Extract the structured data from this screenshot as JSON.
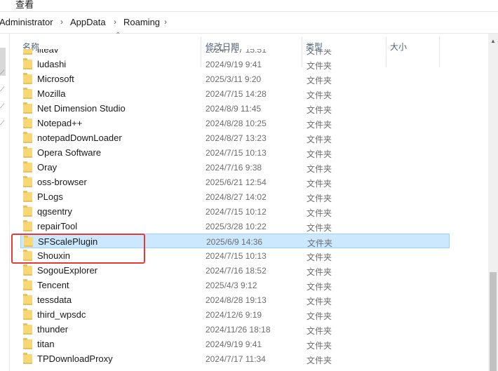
{
  "menu": {
    "view_label": "查看"
  },
  "breadcrumb": [
    "Administrator",
    "AppData",
    "Roaming"
  ],
  "columns": {
    "name": "名称",
    "date": "修改日期",
    "type": "类型",
    "size": "大小"
  },
  "files": [
    {
      "name": "liteav",
      "date": "2024/7/17 15:51",
      "type": "文件夹"
    },
    {
      "name": "ludashi",
      "date": "2024/9/19 9:41",
      "type": "文件夹"
    },
    {
      "name": "Microsoft",
      "date": "2025/3/11 9:20",
      "type": "文件夹"
    },
    {
      "name": "Mozilla",
      "date": "2024/7/15 14:28",
      "type": "文件夹"
    },
    {
      "name": "Net Dimension Studio",
      "date": "2024/8/9 11:45",
      "type": "文件夹"
    },
    {
      "name": "Notepad++",
      "date": "2024/8/28 10:25",
      "type": "文件夹"
    },
    {
      "name": "notepadDownLoader",
      "date": "2024/8/27 13:23",
      "type": "文件夹"
    },
    {
      "name": "Opera Software",
      "date": "2024/7/15 10:13",
      "type": "文件夹"
    },
    {
      "name": "Oray",
      "date": "2024/7/16 9:38",
      "type": "文件夹"
    },
    {
      "name": "oss-browser",
      "date": "2025/6/21 12:54",
      "type": "文件夹"
    },
    {
      "name": "PLogs",
      "date": "2024/8/27 14:02",
      "type": "文件夹"
    },
    {
      "name": "qgsentry",
      "date": "2024/7/15 10:12",
      "type": "文件夹"
    },
    {
      "name": "repairTool",
      "date": "2025/3/28 10:22",
      "type": "文件夹"
    },
    {
      "name": "SFScalePlugin",
      "date": "2025/6/9 14:36",
      "type": "文件夹",
      "selected": true
    },
    {
      "name": "Shouxin",
      "date": "2024/7/15 10:13",
      "type": "文件夹"
    },
    {
      "name": "SogouExplorer",
      "date": "2024/7/16 18:52",
      "type": "文件夹"
    },
    {
      "name": "Tencent",
      "date": "2025/4/3 9:12",
      "type": "文件夹"
    },
    {
      "name": "tessdata",
      "date": "2024/8/28 19:13",
      "type": "文件夹"
    },
    {
      "name": "third_wpsdc",
      "date": "2024/12/6 9:19",
      "type": "文件夹"
    },
    {
      "name": "thunder",
      "date": "2024/11/26 18:18",
      "type": "文件夹"
    },
    {
      "name": "titan",
      "date": "2024/9/19 9:41",
      "type": "文件夹"
    },
    {
      "name": "TPDownloadProxy",
      "date": "2024/7/17 11:34",
      "type": "文件夹"
    }
  ],
  "colors": {
    "selection_bg": "#cce8ff",
    "selection_border": "#99d1ff",
    "annotation_box": "#e53935",
    "folder": "#f8d775"
  },
  "icons": {
    "folder": "folder-icon",
    "pin": "pin-icon",
    "sort": "sort-up-icon",
    "breadcrumb_separator": "chevron-right-icon"
  }
}
